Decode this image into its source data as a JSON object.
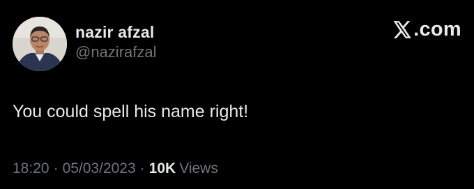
{
  "author": {
    "display_name": "nazir afzal",
    "handle": "@nazirafzal"
  },
  "brand": {
    "icon": "x-logo-icon",
    "text": ".com"
  },
  "tweet": {
    "text": "You could spell his name right!"
  },
  "meta": {
    "time": "18:20",
    "date": "05/03/2023",
    "separator": "·",
    "views_count": "10K",
    "views_label": "Views"
  },
  "colors": {
    "background": "#000000",
    "primary_text": "#e7e9ea",
    "secondary_text": "#71767b"
  }
}
